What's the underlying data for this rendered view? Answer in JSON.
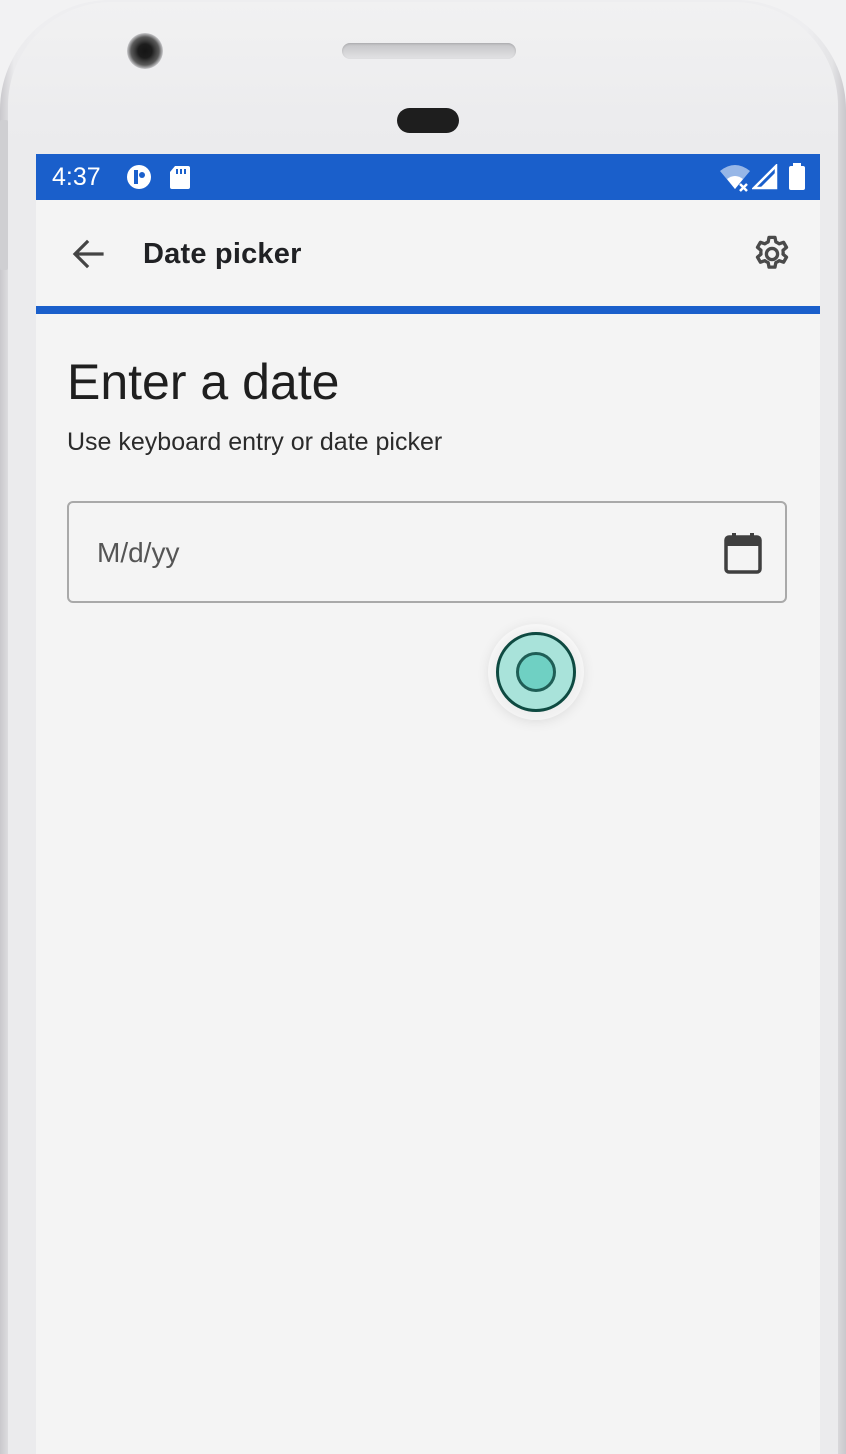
{
  "status_bar": {
    "time": "4:37",
    "icons": [
      "accessibility-app-icon",
      "sd-card-icon",
      "wifi-icon",
      "signal-icon",
      "battery-icon"
    ],
    "color": "#1a5fcb"
  },
  "app_bar": {
    "title": "Date picker",
    "back_icon": "arrow-back-icon",
    "settings_icon": "gear-icon"
  },
  "main": {
    "heading": "Enter a date",
    "subheading": "Use keyboard entry or date picker",
    "date_field": {
      "placeholder": "M/d/yy",
      "value": "",
      "icon": "calendar-icon"
    }
  },
  "colors": {
    "accent": "#1a5fcb",
    "screen_background": "#f4f4f4",
    "touch_indicator": "#6fd0c3"
  }
}
